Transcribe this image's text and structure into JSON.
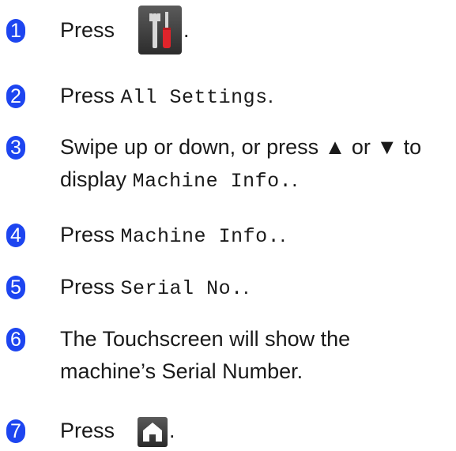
{
  "steps": [
    {
      "number": "1",
      "parts": [
        "Press",
        "."
      ]
    },
    {
      "number": "2",
      "parts": [
        "Press",
        "All Settings",
        "."
      ]
    },
    {
      "number": "3",
      "parts": [
        "Swipe up or down, or press ▲ or ▼ to",
        "display",
        "Machine Info.",
        "."
      ]
    },
    {
      "number": "4",
      "parts": [
        "Press",
        "Machine Info.",
        "."
      ]
    },
    {
      "number": "5",
      "parts": [
        "Press",
        "Serial No.",
        "."
      ]
    },
    {
      "number": "6",
      "parts": [
        "The Touchscreen will show the",
        "machine’s Serial Number."
      ]
    },
    {
      "number": "7",
      "parts": [
        "Press",
        "."
      ]
    }
  ],
  "icons": {
    "settings": "tools-icon",
    "home": "home-icon"
  },
  "colors": {
    "step_badge": "#1d45f0",
    "icon_bg": "#3a3a3a"
  }
}
